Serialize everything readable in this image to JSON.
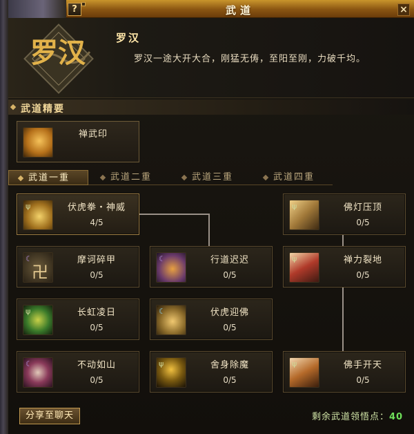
{
  "window": {
    "title": "武道",
    "help_label": "?",
    "close_label": "×"
  },
  "header": {
    "emblem_text": "罗汉",
    "class_name": "罗汉",
    "description": "罗汉一途大开大合，刚猛无俦，至阳至刚，力破千均。"
  },
  "section": {
    "label": "武道精要"
  },
  "featured_skill": {
    "name": "禅武印",
    "icon": "fist-gold-icon"
  },
  "tabs": [
    {
      "label": "武道一重",
      "active": true
    },
    {
      "label": "武道二重",
      "active": false
    },
    {
      "label": "武道三重",
      "active": false
    },
    {
      "label": "武道四重",
      "active": false
    }
  ],
  "skills": [
    {
      "name": "伏虎拳・神威",
      "level": "4/5",
      "icon": "fist-icon",
      "selected": true
    },
    {
      "name": "佛灯压顶",
      "level": "0/5",
      "icon": "lamp-icon"
    },
    {
      "name": "摩诃碎甲",
      "level": "0/5",
      "icon": "swastika-icon"
    },
    {
      "name": "行道迟迟",
      "level": "0/5",
      "icon": "spirit-fist-icon"
    },
    {
      "name": "禅力裂地",
      "level": "0/5",
      "icon": "red-gauntlet-icon"
    },
    {
      "name": "长虹凌日",
      "level": "0/5",
      "icon": "green-arc-icon"
    },
    {
      "name": "伏虎迎佛",
      "level": "0/5",
      "icon": "palm-icon"
    },
    {
      "name": "不动如山",
      "level": "0/5",
      "icon": "monk-face-icon"
    },
    {
      "name": "舍身除魔",
      "level": "0/5",
      "icon": "monk-silhouette-icon"
    },
    {
      "name": "佛手开天",
      "level": "0/5",
      "icon": "open-hand-icon"
    }
  ],
  "footer": {
    "share_label": "分享至聊天",
    "points_label": "剩余武道领悟点：",
    "points_value": "40"
  },
  "colors": {
    "accent": "#c9952c",
    "points_green": "#6fe05a",
    "text": "#f2e5c6"
  }
}
